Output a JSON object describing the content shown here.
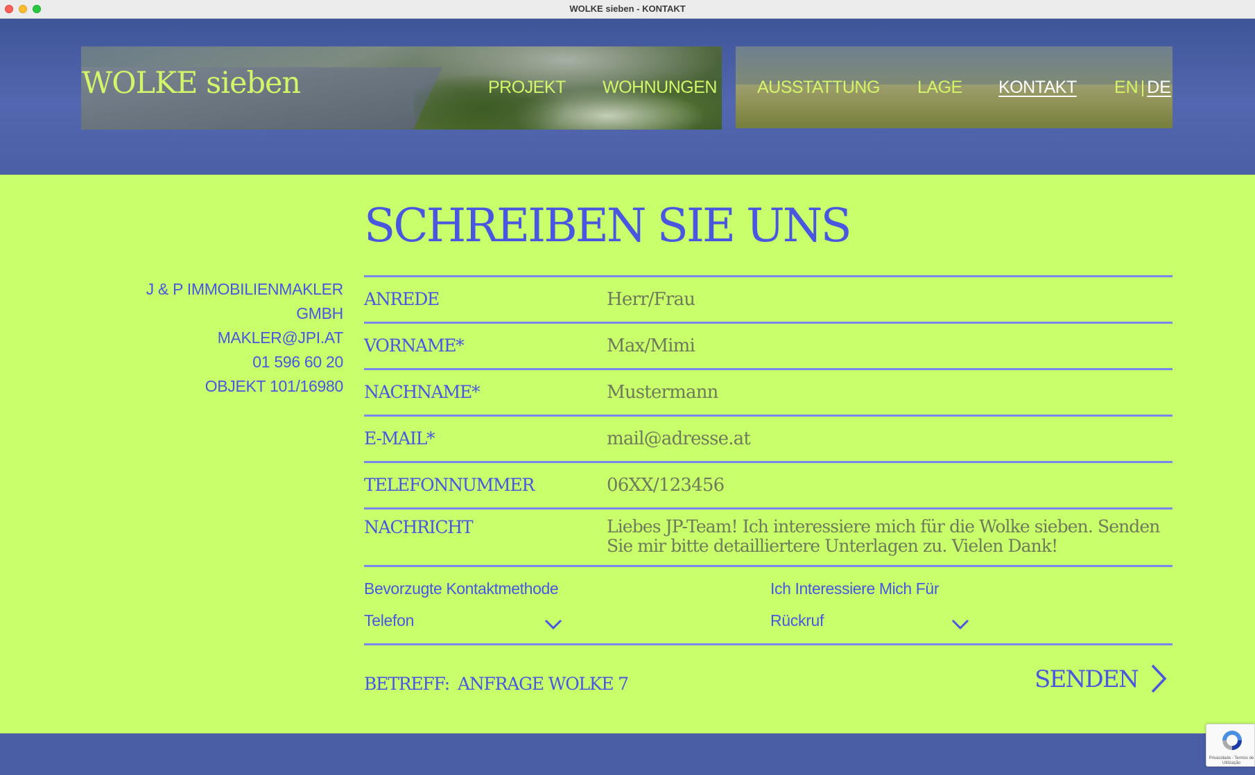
{
  "window": {
    "title": "WOLKE sieben - KONTAKT"
  },
  "header": {
    "logo": "WOLKE sieben",
    "nav": [
      "PROJEKT",
      "WOHNUNGEN",
      "AUSSTATTUNG",
      "LAGE",
      "KONTAKT"
    ],
    "active_nav": "KONTAKT",
    "lang_en": "EN",
    "lang_sep": "|",
    "lang_de": "DE"
  },
  "contact": {
    "company_line1": "J & P IMMOBILIENMAKLER",
    "company_line2": "GMBH",
    "email": "MAKLER@JPI.AT",
    "phone": "01 596 60 20",
    "object": "OBJEKT 101/16980"
  },
  "form": {
    "title": "SCHREIBEN SIE UNS",
    "fields": [
      {
        "label": "ANREDE",
        "placeholder": "Herr/Frau"
      },
      {
        "label": "VORNAME*",
        "placeholder": "Max/Mimi"
      },
      {
        "label": "NACHNAME*",
        "placeholder": "Mustermann"
      },
      {
        "label": "E-MAIL*",
        "placeholder": "mail@adresse.at"
      },
      {
        "label": "TELEFONNUMMER",
        "placeholder": "06XX/123456"
      },
      {
        "label": "NACHRICHT",
        "placeholder": "Liebes JP-Team! Ich interessiere mich für die Wolke sieben. Senden Sie mir bitte detailliertere Unterlagen zu. Vielen Dank!"
      }
    ],
    "contact_method": {
      "label": "Bevorzugte Kontaktmethode",
      "value": "Telefon"
    },
    "interest": {
      "label": "Ich Interessiere Mich Für",
      "value": "Rückruf"
    },
    "subject_label": "BETREFF:",
    "subject_value": "ANFRAGE WOLKE 7",
    "submit": "SENDEN"
  },
  "recaptcha": {
    "text": "Privacidade - Termos de Utilização"
  },
  "colors": {
    "lime": "#c8ff6a",
    "blue": "#4856e0",
    "header_blue": "#4a5ea6",
    "logo_lime": "#d4f56a"
  }
}
